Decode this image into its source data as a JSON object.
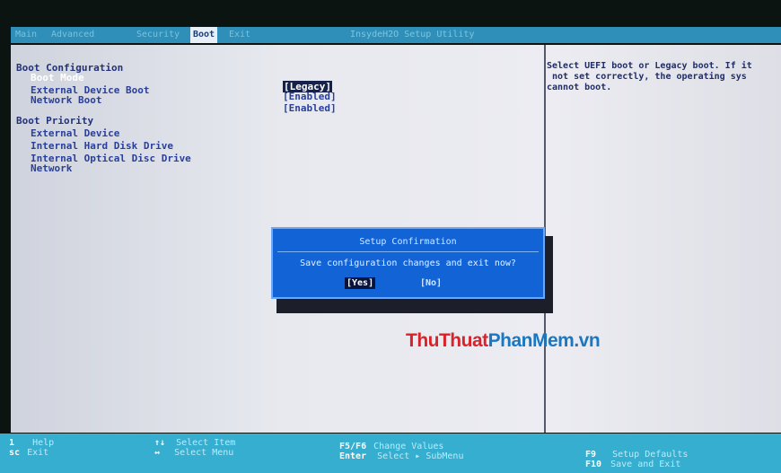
{
  "menu": {
    "tabs": [
      {
        "label": "Main"
      },
      {
        "label": "Advanced"
      },
      {
        "label": "Security"
      },
      {
        "label": "Boot"
      },
      {
        "label": "Exit"
      }
    ],
    "active_tab": "Boot",
    "utility_title": "InsydeH2O Setup Utility"
  },
  "boot_config": {
    "heading": "Boot Configuration",
    "items": [
      {
        "label": "Boot Mode",
        "value": "[Legacy]"
      },
      {
        "label": "External Device Boot",
        "value": "[Enabled]"
      },
      {
        "label": "Network Boot",
        "value": "[Enabled]"
      }
    ]
  },
  "boot_priority": {
    "heading": "Boot Priority",
    "items": [
      {
        "label": "External Device"
      },
      {
        "label": "Internal Hard Disk Drive"
      },
      {
        "label": "Internal Optical Disc Drive"
      },
      {
        "label": "Network"
      }
    ]
  },
  "help": {
    "lines": [
      "Select UEFI boot or Legacy boot. If it",
      " not set correctly, the operating sys",
      "cannot boot."
    ]
  },
  "dialog": {
    "title": "Setup Confirmation",
    "message": "Save configuration changes and exit now?",
    "yes": "[Yes]",
    "no": "[No]"
  },
  "watermark": {
    "part1": "ThuThuat",
    "part2": "PhanMem",
    "part3": ".vn",
    "color_red": "#d8232a",
    "color_blue": "#1a78c2"
  },
  "footer": {
    "help_key": "1",
    "help_label": "Help",
    "exit_key": "sc",
    "exit_label": "Exit",
    "select_item_key": "↑↓",
    "select_item_label": "Select Item",
    "select_menu_key": "↔",
    "select_menu_label": "Select Menu",
    "change_values_key": "F5/F6",
    "change_values_label": "Change Values",
    "enter_key": "Enter",
    "enter_label": "Select ▸ SubMenu",
    "defaults_key": "F9",
    "defaults_label": "Setup Defaults",
    "save_key": "F10",
    "save_label": "Save and Exit"
  },
  "colors": {
    "topbar": "#2f8fb8",
    "dialog": "#1263d6",
    "bottombar": "#36aed0",
    "panel": "#e7e9ef"
  }
}
